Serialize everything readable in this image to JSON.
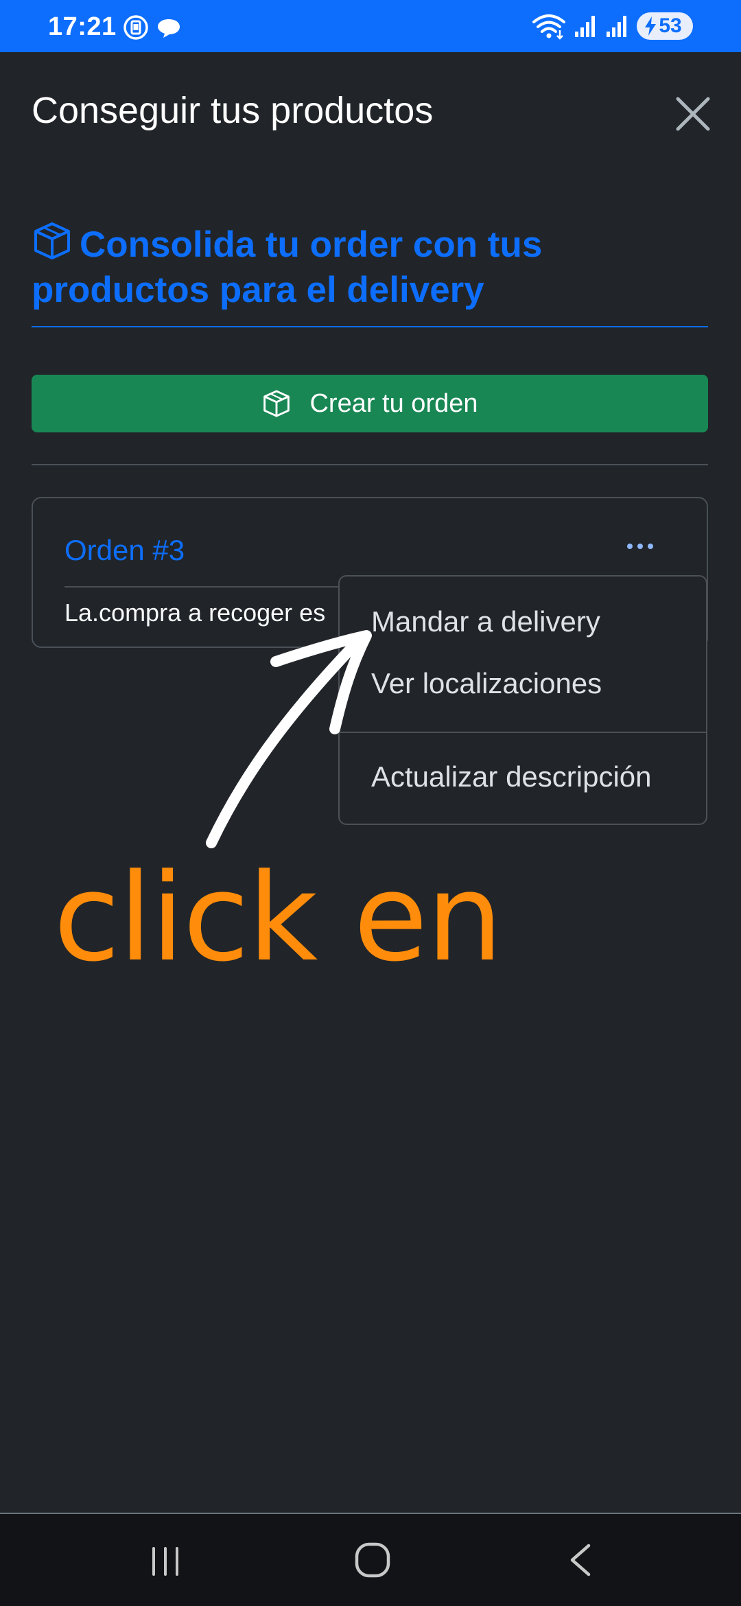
{
  "status_bar": {
    "time": "17:21",
    "battery": "53",
    "icons": [
      "screen-record-icon",
      "chat-bubble-icon",
      "wifi-icon",
      "signal-icon",
      "signal-icon",
      "battery-charging-icon"
    ]
  },
  "header": {
    "title": "Conseguir tus productos",
    "close_icon": "close-icon"
  },
  "section": {
    "heading": "Consolida tu order con tus productos para el delivery",
    "icon": "box-icon"
  },
  "create_button": {
    "label": "Crear tu orden",
    "icon": "box-icon"
  },
  "order_card": {
    "title": "Orden #3",
    "description": "La.compra a recoger es",
    "menu_icon": "more-horizontal-icon"
  },
  "dropdown": {
    "items": [
      {
        "label": "Mandar a delivery"
      },
      {
        "label": "Ver localizaciones"
      },
      {
        "label": "Actualizar descripción"
      }
    ]
  },
  "annotation": {
    "text": "click en",
    "color": "#ff8c0a",
    "icon": "arrow-icon"
  },
  "colors": {
    "primary": "#0d6efd",
    "success": "#198754",
    "background": "#212529"
  },
  "nav_bar": {
    "icons": [
      "recent-apps-icon",
      "home-icon",
      "back-icon"
    ]
  }
}
